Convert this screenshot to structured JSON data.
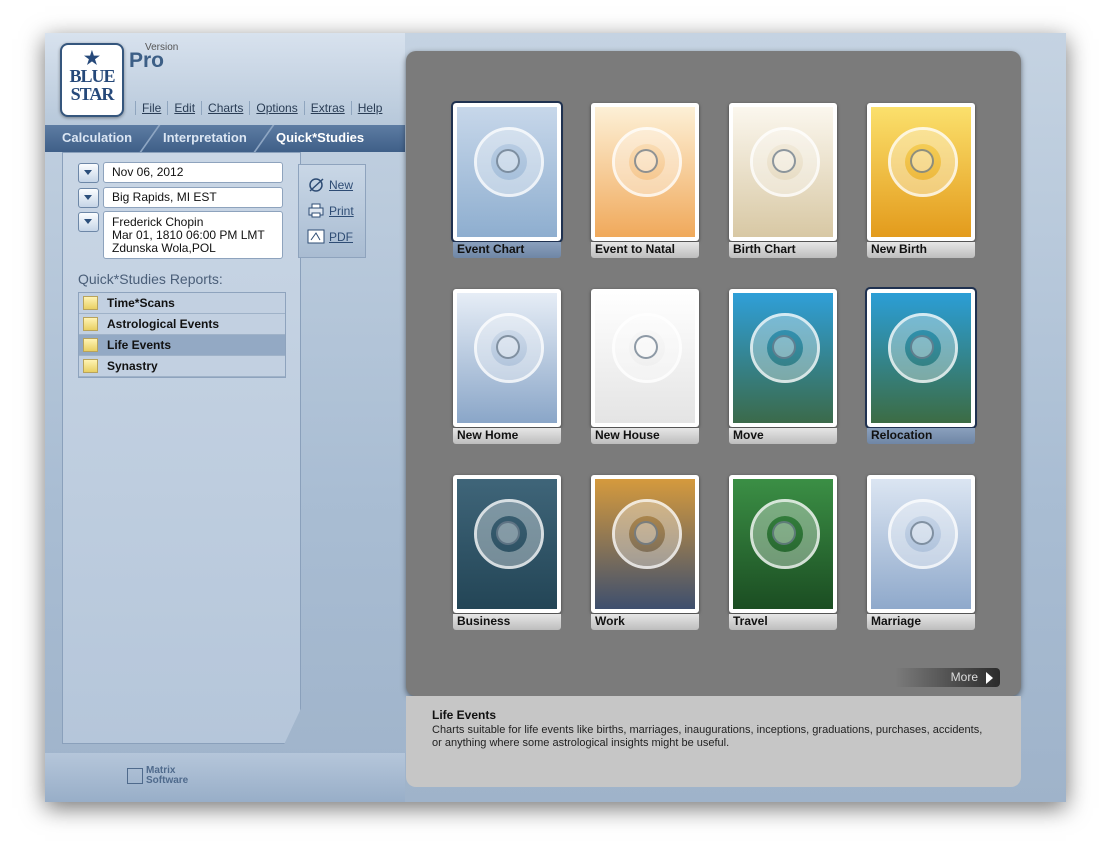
{
  "app": {
    "logo_line1": "BLUE",
    "logo_line2": "STAR",
    "version_label": "Version",
    "edition": "Pro"
  },
  "menu": [
    "File",
    "Edit",
    "Charts",
    "Options",
    "Extras",
    "Help"
  ],
  "tabs": [
    "Calculation",
    "Interpretation",
    "Quick*Studies"
  ],
  "active_tab": "Quick*Studies",
  "fields": {
    "date": "Nov 06, 2012",
    "location": "Big Rapids, MI EST",
    "chart_name": "Frederick Chopin",
    "chart_date": "Mar 01, 1810  06:00 PM LMT",
    "chart_place": "Zdunska Wola,POL"
  },
  "actions": {
    "new": "New",
    "print": "Print",
    "pdf": "PDF"
  },
  "reports_label": "Quick*Studies Reports:",
  "reports": [
    "Time*Scans",
    "Astrological Events",
    "Life Events",
    "Synastry"
  ],
  "selected_report": "Life Events",
  "thumbnails": [
    {
      "label": "Event Chart",
      "selected": true,
      "color1": "#c7d7ea",
      "color2": "#8eaecf"
    },
    {
      "label": "Event to Natal",
      "selected": false,
      "color1": "#fdf0d6",
      "color2": "#f0a95b"
    },
    {
      "label": "Birth Chart",
      "selected": false,
      "color1": "#fbf7ee",
      "color2": "#d8c8a4"
    },
    {
      "label": "New Birth",
      "selected": false,
      "color1": "#fbe06c",
      "color2": "#e39b1c"
    },
    {
      "label": "New Home",
      "selected": false,
      "color1": "#e6edf6",
      "color2": "#8aa6c8"
    },
    {
      "label": "New House",
      "selected": false,
      "color1": "#ffffff",
      "color2": "#e4e4e4"
    },
    {
      "label": "Move",
      "selected": false,
      "color1": "#2f9fd8",
      "color2": "#3b6a4a"
    },
    {
      "label": "Relocation",
      "selected": true,
      "color1": "#2b9ed6",
      "color2": "#3c6c44"
    },
    {
      "label": "Business",
      "selected": false,
      "color1": "#3f6579",
      "color2": "#234556"
    },
    {
      "label": "Work",
      "selected": false,
      "color1": "#d59a3d",
      "color2": "#3e4f6e"
    },
    {
      "label": "Travel",
      "selected": false,
      "color1": "#3b8f45",
      "color2": "#1b4d22"
    },
    {
      "label": "Marriage",
      "selected": false,
      "color1": "#dbe5f2",
      "color2": "#8fa9cb"
    }
  ],
  "more_label": "More",
  "description": {
    "title": "Life Events",
    "text": "Charts suitable for life events like births, marriages, inaugurations, inceptions, graduations, purchases, accidents, or anything where some astrological insights might be useful."
  },
  "footer_brand": {
    "line1": "Matrix",
    "line2": "Software"
  }
}
